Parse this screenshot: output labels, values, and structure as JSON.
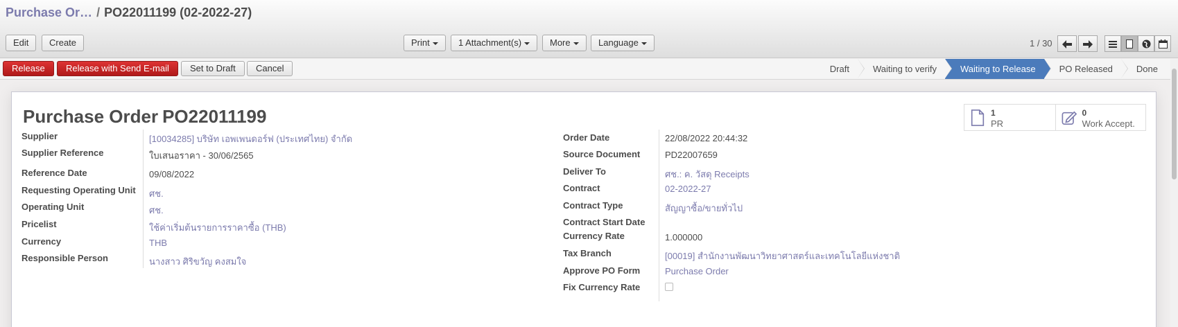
{
  "breadcrumb": {
    "parent": "Purchase Or…",
    "separator": "/",
    "current": "PO22011199 (02-2022-27)"
  },
  "toolbar": {
    "edit": "Edit",
    "create": "Create",
    "print": "Print",
    "attachments": "1 Attachment(s)",
    "more": "More",
    "language": "Language"
  },
  "pager": {
    "value": "1 / 30"
  },
  "actions": {
    "release": "Release",
    "release_send": "Release with Send E-mail",
    "set_to_draft": "Set to Draft",
    "cancel": "Cancel"
  },
  "stages": [
    {
      "label": "Draft",
      "active": false
    },
    {
      "label": "Waiting to verify",
      "active": false
    },
    {
      "label": "Waiting to Release",
      "active": true
    },
    {
      "label": "PO Released",
      "active": false
    },
    {
      "label": "Done",
      "active": false
    }
  ],
  "document": {
    "title": "Purchase Order",
    "number": "PO22011199"
  },
  "smart_buttons": [
    {
      "count": "1",
      "label": "PR",
      "icon": "document-icon"
    },
    {
      "count": "0",
      "label": "Work Accept.",
      "icon": "edit-icon"
    }
  ],
  "left_fields": [
    {
      "label": "Supplier",
      "value": "[10034285] บริษัท เอพเพนดอร์ฟ (ประเทศไทย) จำกัด",
      "link": true
    },
    {
      "label": "Supplier Reference",
      "value": "ใบเสนอราคา - 30/06/2565",
      "link": false
    },
    {
      "label": "Reference Date",
      "value": "09/08/2022",
      "link": false
    },
    {
      "label": "Requesting Operating Unit",
      "value": "ศช.",
      "link": true
    },
    {
      "label": "Operating Unit",
      "value": "ศช.",
      "link": true
    },
    {
      "label": "Pricelist",
      "value": "ใช้ค่าเริ่มต้นรายการราคาซื้อ (THB)",
      "link": true
    },
    {
      "label": "Currency",
      "value": "THB",
      "link": true
    },
    {
      "label": "Responsible Person",
      "value": "นางสาว ศิริขวัญ คงสมใจ",
      "link": true
    }
  ],
  "right_fields": [
    {
      "label": "Order Date",
      "value": "22/08/2022 20:44:32",
      "link": false
    },
    {
      "label": "Source Document",
      "value": "PD22007659",
      "link": false
    },
    {
      "label": "Deliver To",
      "value": "ศช.: ค. วัสดุ Receipts",
      "link": true
    },
    {
      "label": "Contract",
      "value": "02-2022-27",
      "link": true
    },
    {
      "label": "Contract Type",
      "value": "สัญญาซื้อ/ขายทั่วไป",
      "link": true
    },
    {
      "label": "Contract Start Date",
      "value": "",
      "link": false
    },
    {
      "label": "Currency Rate",
      "value": "1.000000",
      "link": false
    },
    {
      "label": "Tax Branch",
      "value": "[00019] สำนักงานพัฒนาวิทยาศาสตร์และเทคโนโลยีแห่งชาติ",
      "link": true
    },
    {
      "label": "Approve PO Form",
      "value": "Purchase Order",
      "link": true
    },
    {
      "label": "Fix Currency Rate",
      "value": "",
      "link": false
    }
  ]
}
